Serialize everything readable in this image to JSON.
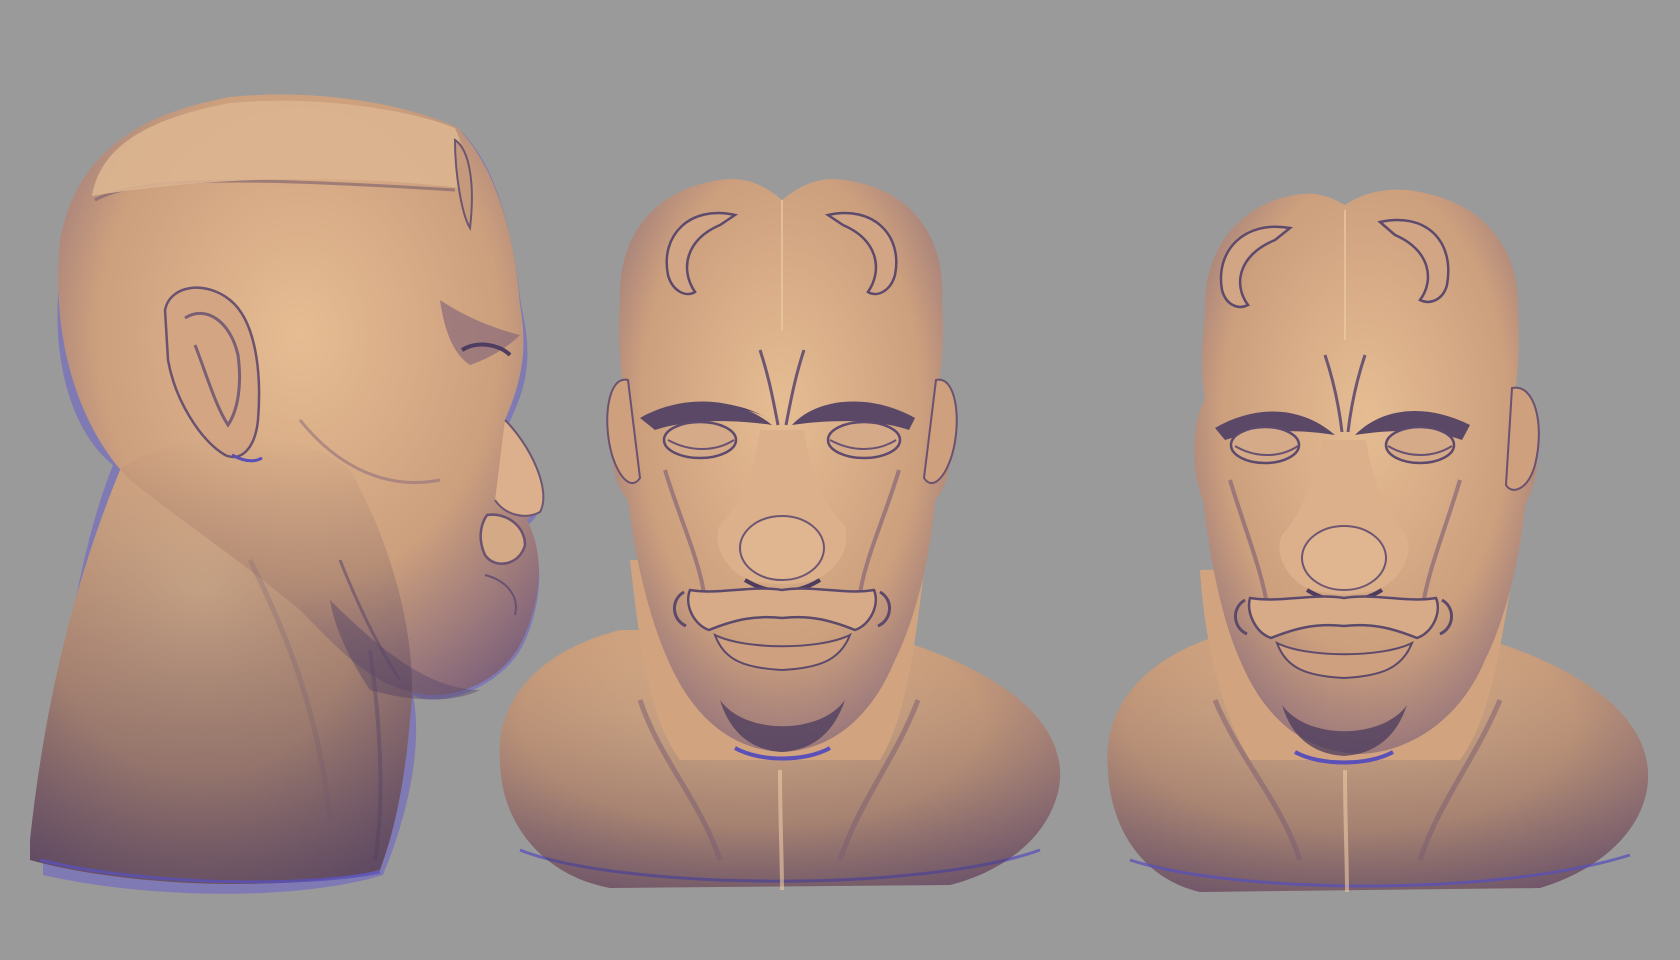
{
  "scene": {
    "background_color": "#9a9a9a",
    "material_color": "#d9ad87",
    "shadow_color": "#5f5076",
    "rim_color": "#6a60c8",
    "views": [
      {
        "name": "side-profile-view",
        "orientation": "profile-right"
      },
      {
        "name": "front-view",
        "orientation": "front"
      },
      {
        "name": "three-quarter-view",
        "orientation": "slight-turn"
      }
    ]
  }
}
